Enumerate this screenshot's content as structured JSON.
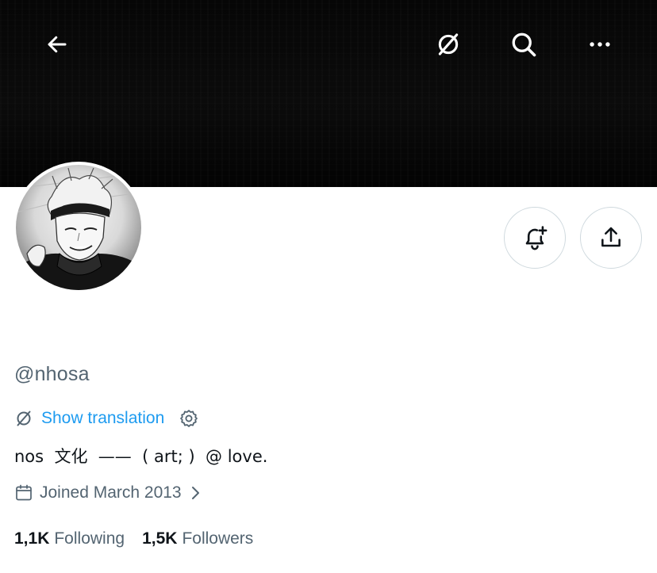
{
  "profile": {
    "handle": "@nhosa",
    "show_translation": "Show translation",
    "bio": "nos  文化  ——  ( art; )  @ love.",
    "joined": "Joined March 2013"
  },
  "stats": {
    "following_count": "1,1K",
    "following_label": "Following",
    "followers_count": "1,5K",
    "followers_label": "Followers"
  },
  "icons": {
    "back": "back-arrow-icon",
    "translate": "translate-icon",
    "search": "search-icon",
    "more": "more-icon",
    "notify": "bell-plus-icon",
    "share": "share-icon",
    "settings": "gear-icon",
    "calendar": "calendar-icon",
    "chevron": "chevron-right-icon"
  },
  "colors": {
    "accent": "#1d9bf0",
    "secondary_text": "#536471",
    "primary_text": "#0f1419",
    "banner": "#000000"
  }
}
